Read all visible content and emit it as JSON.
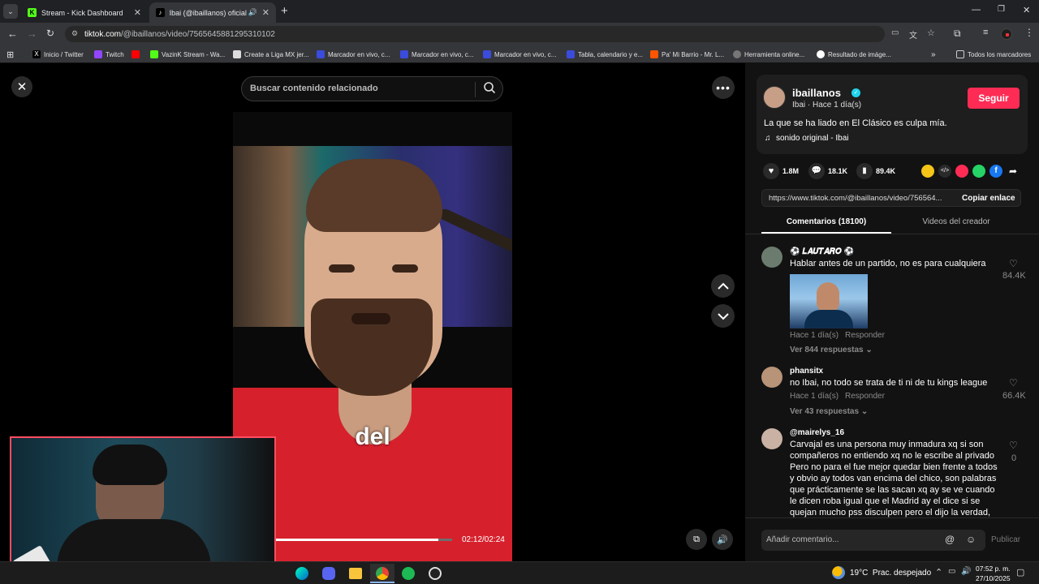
{
  "browser": {
    "tabs": [
      {
        "title": "Stream - Kick Dashboard"
      },
      {
        "title": "Ibai (@ibaillanos) oficial | Ti"
      }
    ],
    "url_domain": "tiktok.com",
    "url_path": "/@ibaillanos/video/7565645881295310102",
    "bookmarks": [
      {
        "label": "Inicio / Twitter"
      },
      {
        "label": "Twitch"
      },
      {
        "label": ""
      },
      {
        "label": "VazinK Stream - Wa..."
      },
      {
        "label": "Create a Liga MX jer..."
      },
      {
        "label": "Marcador en vivo, c..."
      },
      {
        "label": "Marcador en vivo, c..."
      },
      {
        "label": "Marcador en vivo, c..."
      },
      {
        "label": "Tabla, calendario y e..."
      },
      {
        "label": "Pa' Mi Barrio - Mr. L..."
      },
      {
        "label": "Herramienta online..."
      },
      {
        "label": "Resultado de imáge..."
      }
    ],
    "all_bookmarks": "Todos los marcadores"
  },
  "player": {
    "search_placeholder": "Buscar contenido relacionado",
    "caption": "del",
    "time": "02:12/02:24",
    "progress": 0.92
  },
  "creator": {
    "username": "ibaillanos",
    "subline": "Ibai · Hace 1 día(s)",
    "follow_label": "Seguir",
    "description": "La que se ha liado en El Clásico es culpa mía.",
    "sound": "sonido original - Ibai"
  },
  "stats": {
    "likes": "1.8M",
    "comments": "18.1K",
    "saves": "89.4K"
  },
  "share": {
    "link": "https://www.tiktok.com/@ibaillanos/video/756564...",
    "copy_label": "Copiar enlace"
  },
  "tabs": {
    "comments": "Comentarios (18100)",
    "creator_videos": "Videos del creador"
  },
  "comments": [
    {
      "user": "⚽ 𝑳𝑨𝑼𝑻𝑨𝑹𝑶 ⚽",
      "text": "Hablar antes de un partido, no es para cualquiera",
      "time": "Hace 1 día(s)",
      "reply": "Responder",
      "likes": "84.4K",
      "view_replies": "Ver 844 respuestas"
    },
    {
      "user": "phansitx",
      "text": "no Ibai, no todo se trata de ti ni de tu kings league",
      "time": "Hace 1 día(s)",
      "reply": "Responder",
      "likes": "66.4K",
      "view_replies": "Ver 43 respuestas"
    },
    {
      "user": "@mairelys_16",
      "text_lines": [
        "Carvajal es una persona muy inmadura xq si son",
        "compañeros no entiendo xq no le escribe al privado",
        "Pero no para el fue mejor quedar bien frente a todos",
        "y obvio ay todos van encima del chico, son palabras",
        "que prácticamente se las sacan xq ay se ve cuando",
        "le dicen roba igual que el Madrid ay el dice si se",
        "quejan mucho pss disculpen pero el dijo la verdad,"
      ],
      "likes": "0"
    }
  ],
  "comment_input": {
    "placeholder": "Añadir comentario...",
    "post_label": "Publicar"
  },
  "taskbar": {
    "weather": "19°C  Prac. despejado",
    "time": "07:52 p. m.",
    "date": "27/10/2025"
  },
  "colors": {
    "follow": "#fe2c55",
    "accent_tab": "#ffffff",
    "page_bg": "#000000",
    "panel_bg": "#121212"
  }
}
